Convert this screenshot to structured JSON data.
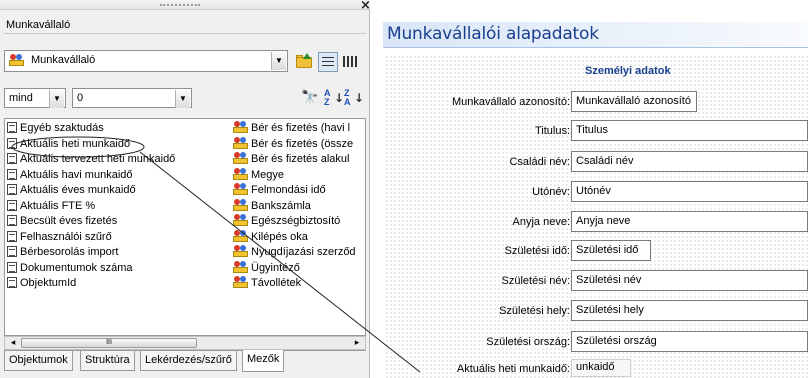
{
  "left_pane": {
    "title": "Munkavállaló",
    "entity_combo_value": "Munkavállaló",
    "scope_combo_value": "mind",
    "number_combo_value": "0",
    "field_items": [
      "Egyéb szaktudás",
      "Aktuális heti munkaidő",
      "Aktuális tervezett heti munkaidő",
      "Aktuális havi munkaidő",
      "Aktuális éves munkaidő",
      "Aktuális FTE %",
      "Becsült éves fizetés",
      "Felhasználói szűrő",
      "Bérbesorolás import",
      "Dokumentumok száma",
      "ObjektumId"
    ],
    "entity_items": [
      "Bér és fizetés (havi l",
      "Bér és fizetés (össze",
      "Bér és fizetés alakul",
      "Megye",
      "Felmondási idő",
      "Bankszámla",
      "Egészségbiztosító",
      "Kilépés oka",
      "Nyugdíjazási szerződ",
      "Ügyintéző",
      "Távollétek"
    ],
    "tabs": [
      "Objektumok",
      "Struktúra",
      "Lekérdezés/szűrő",
      "Mezők"
    ],
    "active_tab": "Mezők",
    "scroll_thumb_glyph": "III",
    "close_glyph": "×",
    "scroll_left_glyph": "◂",
    "scroll_right_glyph": "▸",
    "dropdown_glyph": "▼",
    "sort_asc_letters": [
      "A",
      "Z"
    ],
    "sort_desc_letters": [
      "Z",
      "A"
    ],
    "sort_arrow_glyph": "↓",
    "find_glyph": "🔭",
    "icons": [
      "entity-icon",
      "folder-up-icon",
      "list-view-icon",
      "grid-view-icon",
      "find-icon",
      "sort-ascending-icon",
      "sort-descending-icon",
      "field-doc-icon"
    ]
  },
  "right_pane": {
    "header_title": "Munkavállalói alapadatok",
    "section_title": "Személyi adatok",
    "fields": [
      {
        "label": "Munkavállaló azonosító:",
        "value": "Munkavállaló azonosító"
      },
      {
        "label": "Titulus:",
        "value": "Titulus"
      },
      {
        "label": "Családi név:",
        "value": "Családi név"
      },
      {
        "label": "Utónév:",
        "value": "Utónév"
      },
      {
        "label": "Anyja neve:",
        "value": "Anyja neve"
      },
      {
        "label": "Születési idő:",
        "value": "Születési idő"
      },
      {
        "label": "Születési név:",
        "value": "Születési név"
      },
      {
        "label": "Születési hely:",
        "value": "Születési hely"
      },
      {
        "label": "Születési ország:",
        "value": "Születési ország"
      },
      {
        "label": "Aktuális heti munkaidő:",
        "value": "unkaidő"
      }
    ]
  },
  "colors": {
    "header_text": "#1a3f8f",
    "header_gradient_start": "#d9e6f7",
    "pane_background": "#f0f0f0"
  }
}
